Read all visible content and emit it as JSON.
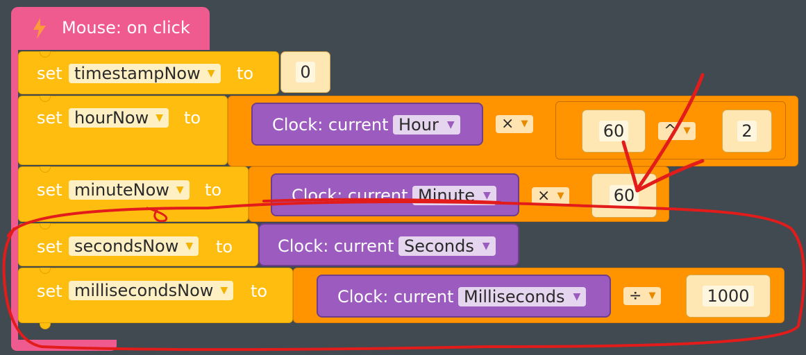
{
  "event": {
    "label": "Mouse: on click",
    "icon": "lightning-icon"
  },
  "set_word": "set",
  "to_word": "to",
  "clock_prefix": "Clock: current",
  "rows": [
    {
      "variable": "timestampNow",
      "value": "0"
    },
    {
      "variable": "hourNow",
      "clock_unit": "Hour",
      "operator": "×",
      "power_base": "60",
      "power_op": "^",
      "power_exp": "2"
    },
    {
      "variable": "minuteNow",
      "clock_unit": "Minute",
      "operator": "×",
      "value": "60"
    },
    {
      "variable": "secondsNow",
      "clock_unit": "Seconds"
    },
    {
      "variable": "millisecondsNow",
      "clock_unit": "Milliseconds",
      "operator": "÷",
      "value": "1000"
    }
  ],
  "annotation_color": "#e21b1b",
  "colors": {
    "event": "#ef5a8f",
    "set": "#ffbd0f",
    "math": "#ff9400",
    "clock": "#9c5bbf",
    "workspace": "#414a51"
  }
}
